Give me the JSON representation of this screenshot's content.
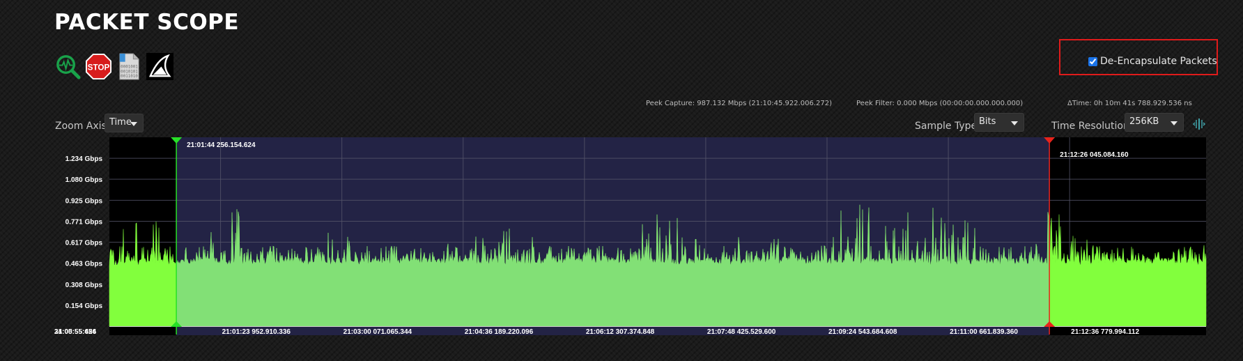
{
  "app": {
    "title": "PACKET SCOPE"
  },
  "toolbar": {
    "items": [
      {
        "name": "analyze",
        "icon": "magnifier-pulse-icon"
      },
      {
        "name": "stop",
        "icon": "stop-sign-icon",
        "label": "STOP"
      },
      {
        "name": "binary-file",
        "icon": "binary-file-icon",
        "lines": [
          "0001001",
          "0010101",
          "0011010"
        ]
      },
      {
        "name": "wireshark",
        "icon": "shark-fin-icon"
      }
    ]
  },
  "options": {
    "decap_label": "De-Encapsulate Packets",
    "decap_checked": true
  },
  "stats": {
    "peek_capture": "Peek Capture: 987.132 Mbps (21:10:45.922.006.272)",
    "peek_filter": "Peek Filter: 0.000 Mbps (00:00:00.000.000.000)",
    "delta_time": "ΔTime: 0h 10m 41s 788.929.536 ns"
  },
  "controls": {
    "zoom_axis_label": "Zoom Axis",
    "zoom_axis_value": "Time",
    "sample_type_label": "Sample Type",
    "sample_type_value": "Bits",
    "time_resolution_label": "Time Resolution",
    "time_resolution_value": "256KB"
  },
  "colors": {
    "plot_bg": "#000000",
    "selection_bg": "#232345",
    "signal_bright": "#82ff3d",
    "signal_dim": "#82e076",
    "start_marker": "#27e027",
    "end_marker": "#e8231b",
    "grid": "#55556a"
  },
  "chart_data": {
    "type": "area",
    "ylabel": "",
    "yticks": [
      "1.234 Gbps",
      "1.080 Gbps",
      "0.925 Gbps",
      "0.771 Gbps",
      "0.617 Gbps",
      "0.463 Gbps",
      "0.308 Gbps",
      "0.154 Gbps"
    ],
    "ytick_values": [
      1.234,
      1.08,
      0.925,
      0.771,
      0.617,
      0.463,
      0.308,
      0.154
    ],
    "ylim": [
      0,
      1.388
    ],
    "xlim_seconds": [
      0,
      868
    ],
    "xticks": [
      {
        "t": 0,
        "label": "34:05:55:624"
      },
      {
        "t": 0,
        "label": "21:00:55:456"
      },
      {
        "t": 88,
        "label": "21:01:23 952.910.336"
      },
      {
        "t": 184,
        "label": "21:03:00 071.065.344"
      },
      {
        "t": 280,
        "label": "21:04:36 189.220.096"
      },
      {
        "t": 376,
        "label": "21:06:12 307.374.848"
      },
      {
        "t": 472,
        "label": "21:07:48 425.529.600"
      },
      {
        "t": 568,
        "label": "21:09:24 543.684.608"
      },
      {
        "t": 664,
        "label": "21:11:00 661.839.360"
      },
      {
        "t": 760,
        "label": "21:12:36 779.994.112"
      }
    ],
    "markers": [
      {
        "name": "start",
        "t": 53,
        "label": "21:01:44 256.154.624"
      },
      {
        "name": "end",
        "t": 744,
        "label": "21:12:26 045.084.160"
      }
    ],
    "baseline_gbps": 0.45,
    "series": [
      {
        "values": [
          0.45,
          0.85,
          0.6,
          0.78,
          0.52,
          0.88,
          0.55,
          0.47,
          0.49,
          0.46,
          0.62,
          0.82,
          0.5,
          0.48,
          0.9,
          0.55,
          0.5,
          0.46,
          0.48,
          0.52,
          0.58,
          0.5,
          0.47,
          0.55,
          0.5,
          0.72,
          0.6,
          0.68,
          0.55,
          0.5,
          0.48,
          0.52,
          0.62,
          0.5,
          0.56,
          0.6,
          0.52,
          0.58,
          0.62,
          0.5,
          0.55,
          0.6,
          0.68,
          0.58,
          0.62,
          0.72,
          0.6,
          0.58,
          0.66,
          0.55,
          0.52,
          0.55,
          0.6,
          0.5,
          0.55,
          0.62,
          0.58,
          0.52,
          0.5,
          0.55,
          0.6,
          0.92,
          0.85,
          0.78,
          0.88,
          0.8,
          0.6,
          0.85,
          0.5,
          0.48,
          0.55,
          0.62,
          0.7,
          0.6,
          0.58,
          0.55,
          0.65,
          0.6,
          0.55,
          0.5,
          0.58,
          0.62,
          0.68,
          0.95,
          0.85,
          0.82,
          0.9,
          0.88,
          0.8,
          0.75,
          0.92,
          0.85,
          0.8,
          0.7,
          0.88,
          0.86,
          0.75,
          0.82,
          0.8,
          0.78,
          0.72,
          0.6,
          0.55,
          0.5,
          0.58,
          0.62,
          0.7,
          0.92,
          0.8,
          0.85,
          0.78,
          0.6,
          0.65,
          0.6,
          0.55,
          0.5,
          0.48,
          0.5,
          0.55,
          0.6,
          0.55,
          0.52,
          0.55,
          0.62,
          0.58,
          0.6
        ]
      }
    ]
  }
}
